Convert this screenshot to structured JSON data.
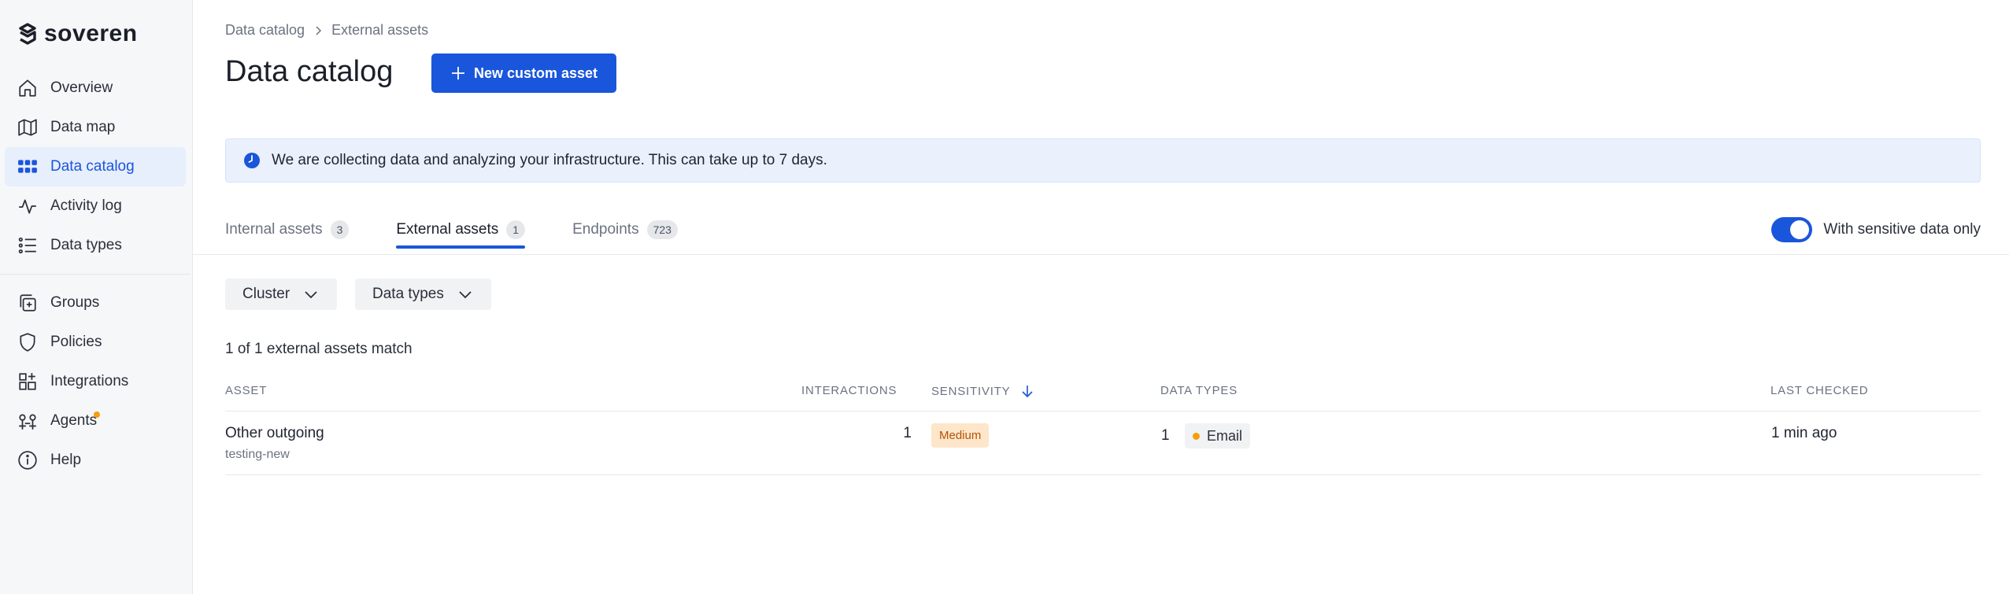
{
  "app": {
    "logo_text": "soveren"
  },
  "sidebar": {
    "items": [
      {
        "label": "Overview",
        "icon": "home-icon"
      },
      {
        "label": "Data map",
        "icon": "map-icon"
      },
      {
        "label": "Data catalog",
        "icon": "grid-icon",
        "active": true
      },
      {
        "label": "Activity log",
        "icon": "activity-icon"
      },
      {
        "label": "Data types",
        "icon": "list-icon"
      }
    ],
    "items2": [
      {
        "label": "Groups",
        "icon": "groups-icon"
      },
      {
        "label": "Policies",
        "icon": "shield-icon"
      },
      {
        "label": "Integrations",
        "icon": "integrations-icon"
      },
      {
        "label": "Agents",
        "icon": "agents-icon",
        "notification": true
      },
      {
        "label": "Help",
        "icon": "info-icon"
      }
    ]
  },
  "breadcrumb": {
    "root": "Data catalog",
    "current": "External assets"
  },
  "page": {
    "title": "Data catalog",
    "new_button": "New custom asset"
  },
  "banner": {
    "text": "We are collecting data and analyzing your infrastructure. This can take up to 7 days."
  },
  "tabs": [
    {
      "label": "Internal assets",
      "count": "3"
    },
    {
      "label": "External assets",
      "count": "1",
      "active": true
    },
    {
      "label": "Endpoints",
      "count": "723"
    }
  ],
  "toggle": {
    "label": "With sensitive data only",
    "on": true
  },
  "filters": {
    "cluster": "Cluster",
    "data_types": "Data types"
  },
  "match_text": "1 of 1 external assets match",
  "table": {
    "headers": {
      "asset": "Asset",
      "interactions": "Interactions",
      "sensitivity": "Sensitivity",
      "data_types": "Data types",
      "last_checked": "Last checked"
    },
    "rows": [
      {
        "asset": "Other outgoing",
        "asset_sub": "testing-new",
        "interactions": "1",
        "sensitivity": "Medium",
        "data_types_count": "1",
        "data_type": "Email",
        "last_checked": "1 min ago"
      }
    ]
  },
  "colors": {
    "accent": "#1a56db",
    "warning": "#f59e0b",
    "medium_badge_bg": "#fde6c9"
  }
}
